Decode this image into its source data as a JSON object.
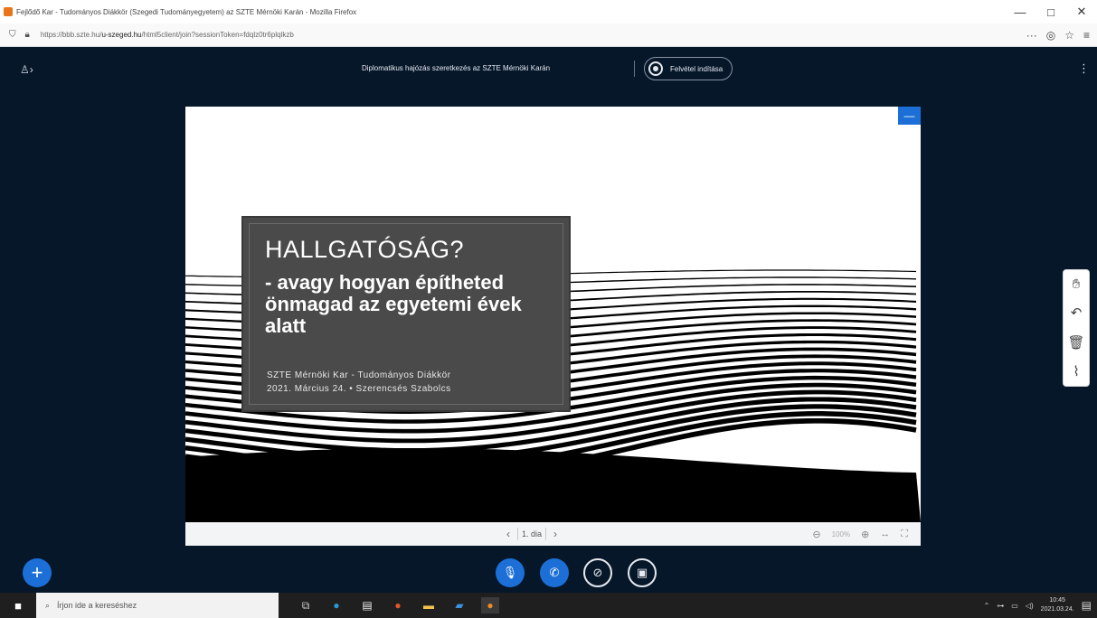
{
  "browser": {
    "window_title": "Fejlődő Kar - Tudományos Diákkör (Szegedi Tudományegyetem) az SZTE Mérnöki Karán - Mozilla Firefox",
    "url_prefix": "https://bbb.szte.hu/",
    "url_domain": "u-szeged.hu",
    "url_rest": "/html5client/join?sessionToken=fdqlz0tr6plqlkzb",
    "controls": {
      "minimize": "—",
      "maximize": "□",
      "close": "✕"
    },
    "toolbar_icons": [
      "more-icon",
      "shield-icon",
      "star-icon",
      "menu-icon"
    ]
  },
  "meeting": {
    "title": "Diplomatikus hajózás szeretkezés az SZTE Mérnöki Karán",
    "recording_label": "Felvétel indítása"
  },
  "slide": {
    "heading": "HALLGATÓSÁG?",
    "subtitle": "- avagy hogyan építheted önmagad az egyetemi évek alatt",
    "meta_line1": "SZTE Mérnöki Kar - Tudományos Diákkör",
    "meta_line2": "2021. Március 24.  •  Szerencsés Szabolcs"
  },
  "slide_toolbar": {
    "prev": "‹",
    "slide_select": "1. dia",
    "next": "›",
    "zoom_out": "⊖",
    "zoom_value": "100%",
    "zoom_in": "⊕",
    "fit_width": "↔",
    "fullscreen": "⛶"
  },
  "whiteboard_tools": [
    "hand-icon",
    "undo-icon",
    "trash-icon",
    "chart-icon"
  ],
  "taskbar": {
    "search_placeholder": "Írjon ide a kereséshez",
    "clock_time": "10:45",
    "clock_date": "2021.03.24."
  },
  "colors": {
    "app_bg": "#06172a",
    "accent": "#1b6fd6",
    "slide_box": "#4a4a4a"
  }
}
